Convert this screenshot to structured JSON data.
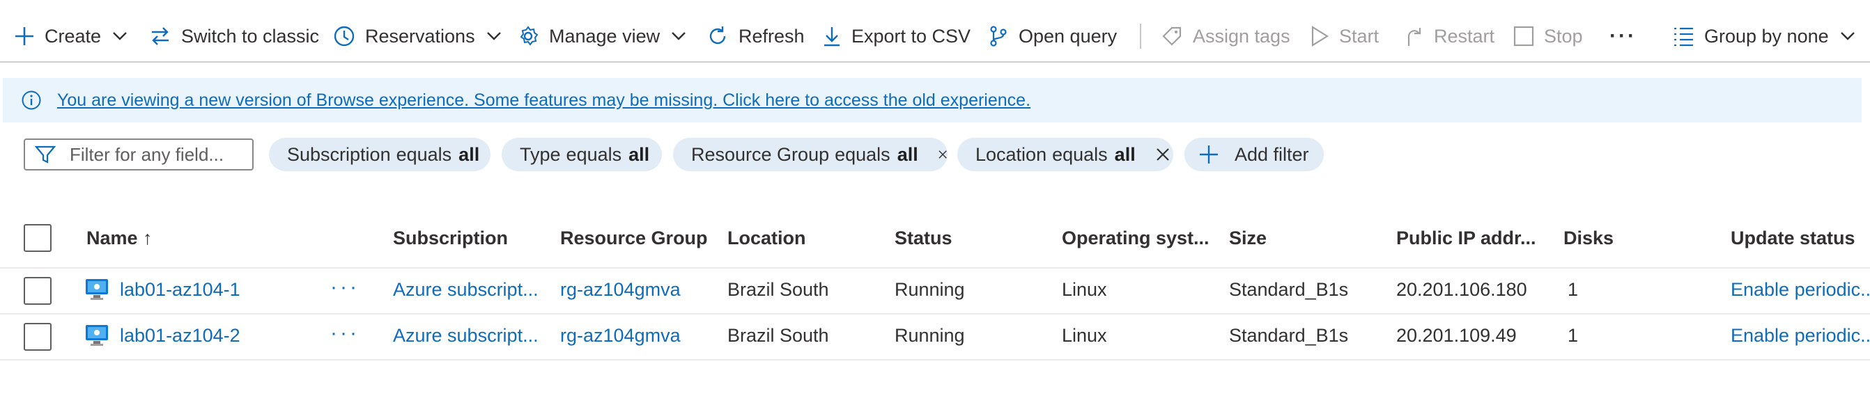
{
  "toolbar": {
    "create": "Create",
    "switch_classic": "Switch to classic",
    "reservations": "Reservations",
    "manage_view": "Manage view",
    "refresh": "Refresh",
    "export_csv": "Export to CSV",
    "open_query": "Open query",
    "assign_tags": "Assign tags",
    "start": "Start",
    "restart": "Restart",
    "stop": "Stop",
    "more": "···",
    "group_by": "Group by none"
  },
  "banner": {
    "message": "You are viewing a new version of Browse experience. Some features may be missing. Click here to access the old experience."
  },
  "filter": {
    "placeholder": "Filter for any field...",
    "pills": [
      {
        "key": "Subscription",
        "op": "equals",
        "value": "all"
      },
      {
        "key": "Type",
        "op": "equals",
        "value": "all"
      },
      {
        "key": "Resource Group",
        "op": "equals",
        "value": "all"
      },
      {
        "key": "Location",
        "op": "equals",
        "value": "all"
      }
    ],
    "add_filter": "Add filter"
  },
  "table": {
    "columns": {
      "name": "Name ↑",
      "subscription": "Subscription",
      "resource_group": "Resource Group",
      "location": "Location",
      "status": "Status",
      "os": "Operating syst...",
      "size": "Size",
      "public_ip": "Public IP addr...",
      "disks": "Disks",
      "update_status": "Update status"
    },
    "rows": [
      {
        "name": "lab01-az104-1",
        "more": "···",
        "subscription": "Azure subscript...",
        "resource_group": "rg-az104gmva",
        "location": "Brazil South",
        "status": "Running",
        "os": "Linux",
        "size": "Standard_B1s",
        "public_ip": "20.201.106.180",
        "disks": "1",
        "update_status": "Enable periodic..."
      },
      {
        "name": "lab01-az104-2",
        "more": "···",
        "subscription": "Azure subscript...",
        "resource_group": "rg-az104gmva",
        "location": "Brazil South",
        "status": "Running",
        "os": "Linux",
        "size": "Standard_B1s",
        "public_ip": "20.201.109.49",
        "disks": "1",
        "update_status": "Enable periodic..."
      }
    ]
  },
  "colors": {
    "accent": "#0f6cbd",
    "banner_bg": "#eaf4fd",
    "pill_bg": "#e1ecf7",
    "disabled": "#a19f9d"
  },
  "icons": {
    "create": "plus-icon",
    "switch": "switch-arrows-icon",
    "reservations": "clock-icon",
    "manage_view": "gear-icon",
    "refresh": "refresh-icon",
    "export": "download-icon",
    "open_query": "query-branch-icon",
    "assign_tags": "tag-icon",
    "start": "play-icon",
    "restart": "restart-icon",
    "stop": "stop-icon",
    "group_by": "list-icon",
    "info": "info-icon",
    "filter": "funnel-icon",
    "vm": "virtual-machine-icon"
  }
}
